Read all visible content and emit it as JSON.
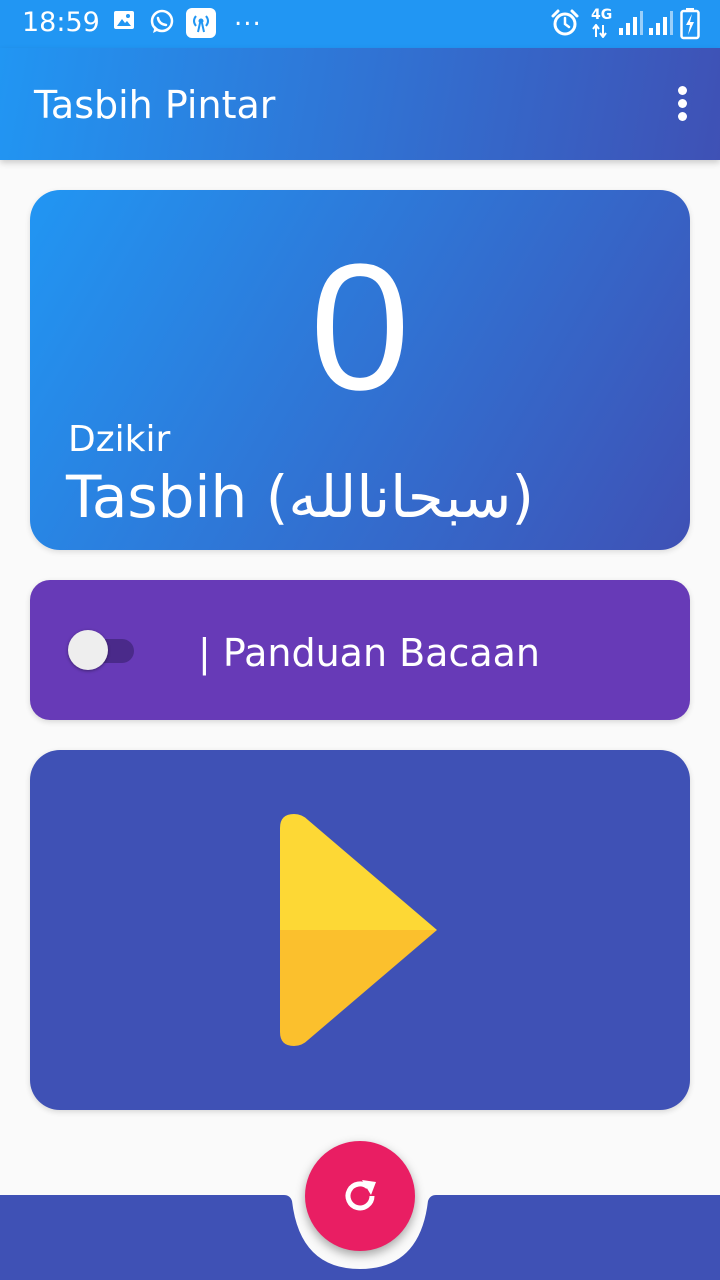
{
  "status_bar": {
    "time": "18:59",
    "more_icon": "...",
    "network_label": "4G"
  },
  "app_bar": {
    "title": "Tasbih Pintar",
    "menu_icon": "more-vert-icon"
  },
  "counter": {
    "count": "0",
    "label": "Dzikir",
    "dzikir_name": "Tasbih (سبحانالله)"
  },
  "guide": {
    "label": "| Panduan Bacaan",
    "toggle_on": false
  },
  "play_button": {
    "icon": "play-icon"
  },
  "reset_button": {
    "icon": "refresh-icon"
  },
  "colors": {
    "primary": "#2196f3",
    "primary_dark": "#3f51b5",
    "guide_card": "#673ab7",
    "play_yellow": "#fdd835",
    "play_yellow_dark": "#fbc02d",
    "fab": "#e91e63"
  }
}
